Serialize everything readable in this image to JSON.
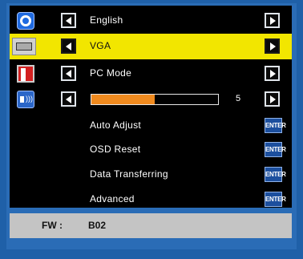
{
  "menu": {
    "rows": [
      {
        "label": "English",
        "icon": "globe-icon"
      },
      {
        "label": "VGA",
        "icon": "vga-port-icon",
        "selected": true
      },
      {
        "label": "PC Mode",
        "icon": "display-mode-icon"
      },
      {
        "icon": "speaker-icon",
        "slider_value": "5",
        "slider_fraction": 0.5
      }
    ],
    "actions": [
      {
        "label": "Auto Adjust",
        "button": "ENTER"
      },
      {
        "label": "OSD Reset",
        "button": "ENTER"
      },
      {
        "label": "Data Transferring",
        "button": "ENTER"
      },
      {
        "label": "Advanced",
        "button": "ENTER"
      }
    ]
  },
  "footer": {
    "fw_label": "FW :",
    "fw_value": "B02"
  },
  "colors": {
    "background": "#1f60a8",
    "panel": "#000000",
    "highlight": "#f2e600",
    "slider_fill": "#f08a1e",
    "enter_button": "#1c4f9e",
    "footer": "#c4c4c4"
  }
}
